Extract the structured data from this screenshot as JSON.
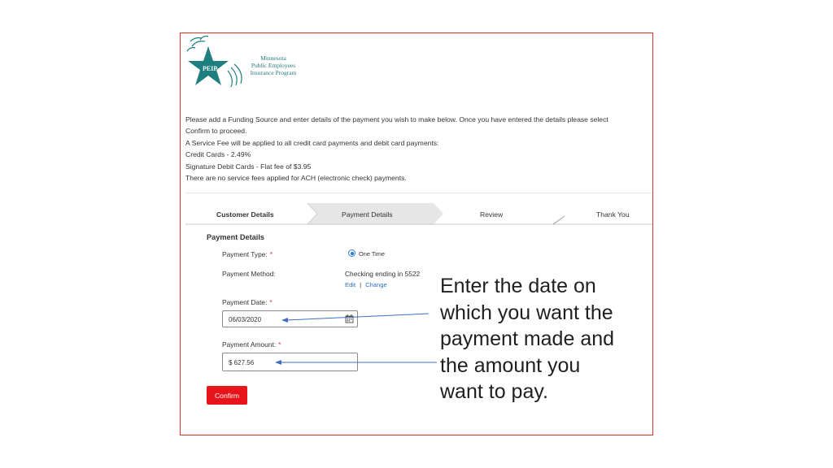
{
  "logo": {
    "badge": "PEIP",
    "lines": [
      "Minnesota",
      "Public Employees",
      "Insurance Program"
    ]
  },
  "instructions": [
    "Please add a Funding Source and enter details of the payment you wish to make below. Once you have entered the details please select",
    "Confirm to proceed.",
    "A Service Fee will be applied to all credit card payments and debit card payments:",
    "Credit Cards - 2.49%",
    "Signature Debit Cards - Flat fee of $3.95",
    "There are no service fees applied for ACH (electronic check) payments."
  ],
  "steps": [
    {
      "label": "Customer Details"
    },
    {
      "label": "Payment Details"
    },
    {
      "label": "Review"
    },
    {
      "label": "Thank You"
    }
  ],
  "form": {
    "section_title": "Payment Details",
    "payment_type_label": "Payment Type:",
    "payment_type_value": "One Time",
    "payment_method_label": "Payment Method:",
    "payment_method_value": "Checking ending in 5522",
    "edit_link": "Edit",
    "link_separator": "|",
    "change_link": "Change",
    "payment_date_label": "Payment Date:",
    "payment_date_value": "06/03/2020",
    "payment_amount_label": "Payment Amount:",
    "payment_amount_value": "$ 627.56",
    "required_marker": "*",
    "confirm_label": "Confirm"
  },
  "callout": [
    "Enter the date on",
    "which you want the",
    "payment made and",
    "the amount you",
    "want to pay."
  ],
  "colors": {
    "frame_border": "#d9302c",
    "logo_teal": "#1f7f80",
    "link_blue": "#2d6fc2",
    "confirm_red": "#e8141c",
    "active_step_bg": "#e6e6e6",
    "arrow_blue": "#3a6fc4"
  }
}
